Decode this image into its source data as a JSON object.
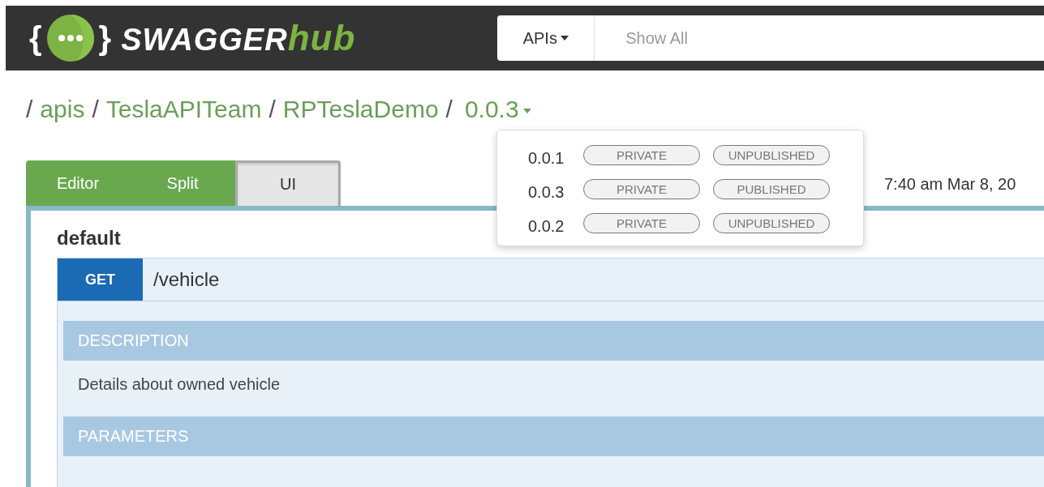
{
  "header": {
    "logo": {
      "brace_open": "{",
      "brace_close": "}",
      "name_main": "SWAGGER",
      "name_accent": "hub"
    },
    "scope_menu": {
      "label": "APIs"
    },
    "search": {
      "placeholder": "Show All"
    }
  },
  "breadcrumb": {
    "separator": "/",
    "items": [
      "apis",
      "TeslaAPITeam",
      "RPTeslaDemo"
    ],
    "version": "0.0.3"
  },
  "version_menu": [
    {
      "version": "0.0.1",
      "visibility": "PRIVATE",
      "status": "UNPUBLISHED"
    },
    {
      "version": "0.0.3",
      "visibility": "PRIVATE",
      "status": "PUBLISHED"
    },
    {
      "version": "0.0.2",
      "visibility": "PRIVATE",
      "status": "UNPUBLISHED"
    }
  ],
  "view_tabs": [
    {
      "label": "Editor",
      "selected": false
    },
    {
      "label": "Split",
      "selected": false
    },
    {
      "label": "UI",
      "selected": true
    }
  ],
  "last_saved": "7:40 am Mar 8, 20",
  "panel": {
    "group": "default",
    "operation": {
      "method": "GET",
      "path": "/vehicle",
      "sections": [
        {
          "title": "DESCRIPTION",
          "text": "Details about owned vehicle"
        },
        {
          "title": "PARAMETERS"
        }
      ]
    }
  }
}
